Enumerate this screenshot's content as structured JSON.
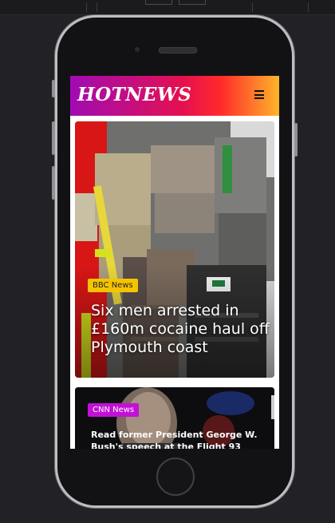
{
  "app": {
    "brand": "HOTNEWS",
    "menu_icon": "hamburger-menu-icon"
  },
  "articles": [
    {
      "source": "BBC News",
      "headline": "Six men arrested in £160m cocaine haul off Plymouth coast",
      "badge_color": "#f5c400"
    },
    {
      "source": "CNN News",
      "headline": "Read former President George W. Bush's speech at the Flight 93",
      "badge_color": "#c211d6"
    }
  ],
  "colors": {
    "header_gradient": [
      "#a10bb3",
      "#e6114e",
      "#ff2a2a",
      "#ffb42b"
    ],
    "phone_body": "#121214",
    "background": "#222226"
  }
}
